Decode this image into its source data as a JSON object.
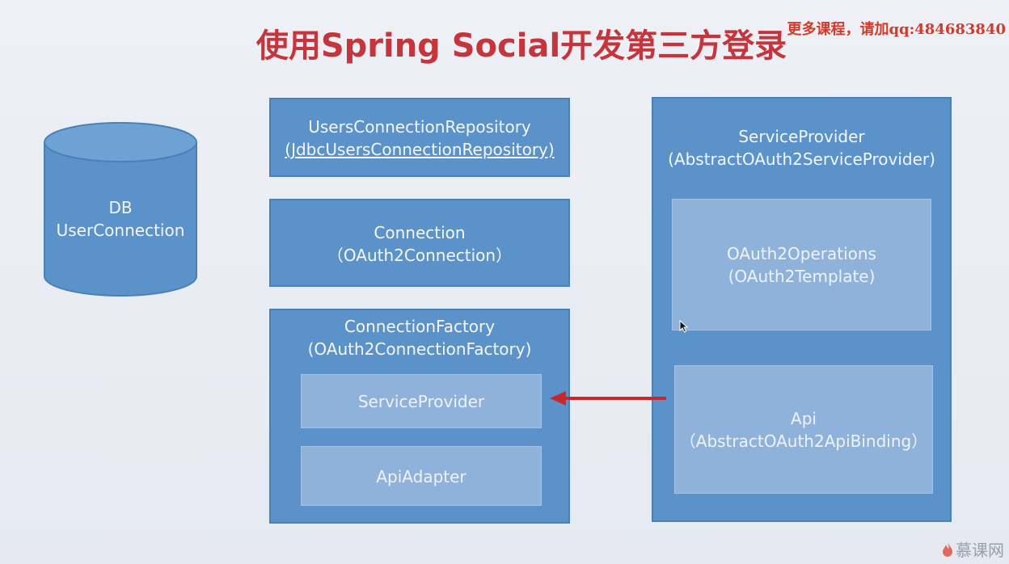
{
  "title": "使用Spring Social开发第三方登录",
  "watermark_top": "更多课程，请加qq:484683840",
  "db": {
    "line1": "DB",
    "line2": "UserConnection"
  },
  "users_connection_repository": {
    "line1": "UsersConnectionRepository",
    "line2": "(JdbcUsersConnectionRepository)"
  },
  "connection": {
    "line1": "Connection",
    "line2": "（OAuth2Connection）"
  },
  "connection_factory": {
    "line1": "ConnectionFactory",
    "line2": "(OAuth2ConnectionFactory)",
    "service_provider": "ServiceProvider",
    "api_adapter": "ApiAdapter"
  },
  "service_provider": {
    "line1": "ServiceProvider",
    "line2": "(AbstractOAuth2ServiceProvider)",
    "oauth2_operations": {
      "line1": "OAuth2Operations",
      "line2": "(OAuth2Template)"
    },
    "api": {
      "line1": "Api",
      "line2": "（AbstractOAuth2ApiBinding）"
    }
  },
  "logo_text": "慕课网",
  "colors": {
    "title": "#c5363c",
    "box_fill": "#5b92c9",
    "inner_fill": "#8fb2db",
    "arrow": "#c8282c",
    "background": "#e9ecf3"
  }
}
